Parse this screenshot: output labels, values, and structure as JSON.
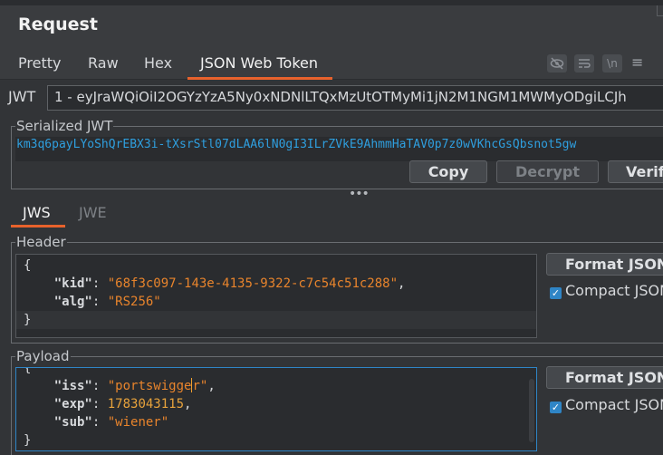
{
  "panel": {
    "title": "Request"
  },
  "tabs": [
    {
      "label": "Pretty"
    },
    {
      "label": "Raw"
    },
    {
      "label": "Hex"
    },
    {
      "label": "JSON Web Token"
    }
  ],
  "toolbar_icons": [
    "eye-off-icon",
    "wrap-lines-icon",
    "newline-icon",
    "menu-icon"
  ],
  "toolbar_glyphs": {
    "newline": "\\n",
    "menu": "≡"
  },
  "jwt": {
    "label": "JWT",
    "selected": "1 - eyJraWQiOiI2OGYzYzA5Ny0xNDNlLTQxMzUtOTMyMi1jN2M1NGM1MWMyODgiLCJh"
  },
  "serialized": {
    "legend": "Serialized JWT",
    "line1": "km3q6payLYoShQrEBX3i-tXsrStl07dLAA6lN0gI3ILrZVkE9AhmmHaTAV0p7z0wVKhcGsQbsnot5gw",
    "line2": "",
    "buttons": {
      "copy": "Copy",
      "decrypt": "Decrypt",
      "verify": "Verify"
    }
  },
  "splitter": "•••",
  "sub_tabs": [
    {
      "label": "JWS"
    },
    {
      "label": "JWE"
    }
  ],
  "header": {
    "legend": "Header",
    "kid_key": "\"kid\"",
    "kid_value": "\"68f3c097-143e-4135-9322-c7c54c51c288\"",
    "alg_key": "\"alg\"",
    "alg_value": "\"RS256\"",
    "format_button": "Format JSON",
    "compact_label": "Compact JSON"
  },
  "payload": {
    "legend": "Payload",
    "iss_key": "\"iss\"",
    "iss_value_a": "\"portswigge",
    "iss_value_b": "r\"",
    "exp_key": "\"exp\"",
    "exp_value": "1783043115",
    "sub_key": "\"sub\"",
    "sub_value": "\"wiener\"",
    "format_button": "Format JSON",
    "compact_label": "Compact JSON"
  },
  "colors": {
    "accent": "#e8622c",
    "link_blue": "#2f9fdf",
    "string_orange": "#e8842c"
  }
}
